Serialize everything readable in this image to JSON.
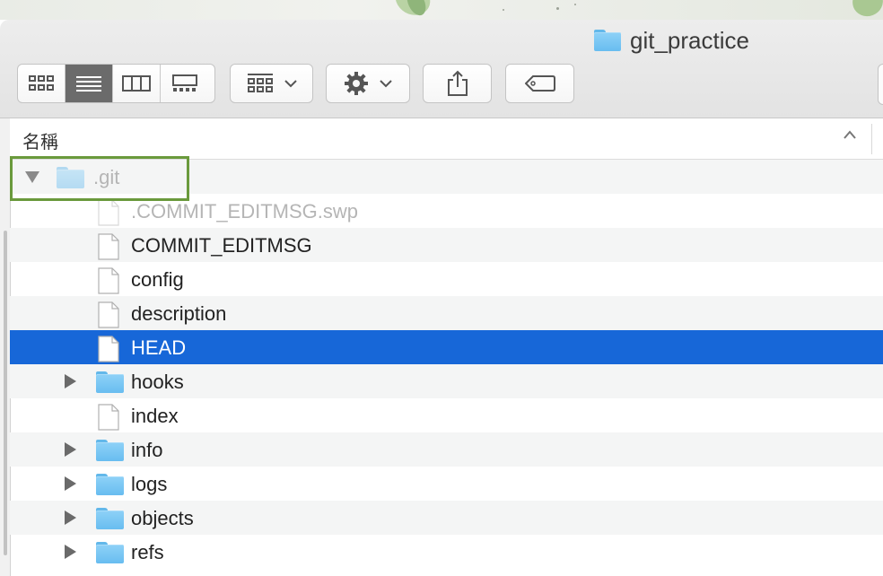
{
  "window": {
    "title": "git_practice",
    "title_icon": "folder-icon"
  },
  "toolbar": {
    "view_buttons": [
      {
        "name": "icon-view",
        "icon": "grid-icon"
      },
      {
        "name": "list-view",
        "icon": "list-icon",
        "active": true
      },
      {
        "name": "column-view",
        "icon": "columns-icon"
      },
      {
        "name": "gallery-view",
        "icon": "gallery-icon"
      }
    ],
    "group_button_icon": "group-grid-icon",
    "action_button_icon": "gear-icon",
    "share_button_icon": "share-icon",
    "tag_button_icon": "tag-icon"
  },
  "list": {
    "column_header": "名稱",
    "sort_indicator": "chevron-up-icon",
    "rows": [
      {
        "label": ".git",
        "kind": "folder",
        "expanded": true,
        "dimmed": true,
        "indent": 0
      },
      {
        "label": ".COMMIT_EDITMSG.swp",
        "kind": "file",
        "dimmed": true,
        "indent": 1
      },
      {
        "label": "COMMIT_EDITMSG",
        "kind": "file",
        "indent": 1
      },
      {
        "label": "config",
        "kind": "file",
        "indent": 1
      },
      {
        "label": "description",
        "kind": "file",
        "indent": 1
      },
      {
        "label": "HEAD",
        "kind": "file",
        "selected": true,
        "indent": 1
      },
      {
        "label": "hooks",
        "kind": "folder",
        "expanded": false,
        "indent": 1
      },
      {
        "label": "index",
        "kind": "file",
        "indent": 1
      },
      {
        "label": "info",
        "kind": "folder",
        "expanded": false,
        "indent": 1
      },
      {
        "label": "logs",
        "kind": "folder",
        "expanded": false,
        "indent": 1
      },
      {
        "label": "objects",
        "kind": "folder",
        "expanded": false,
        "indent": 1
      },
      {
        "label": "refs",
        "kind": "folder",
        "expanded": false,
        "indent": 1
      }
    ]
  },
  "colors": {
    "selection": "#1767d8",
    "highlight_border": "#6a9a3c",
    "folder": "#68bdf0"
  }
}
